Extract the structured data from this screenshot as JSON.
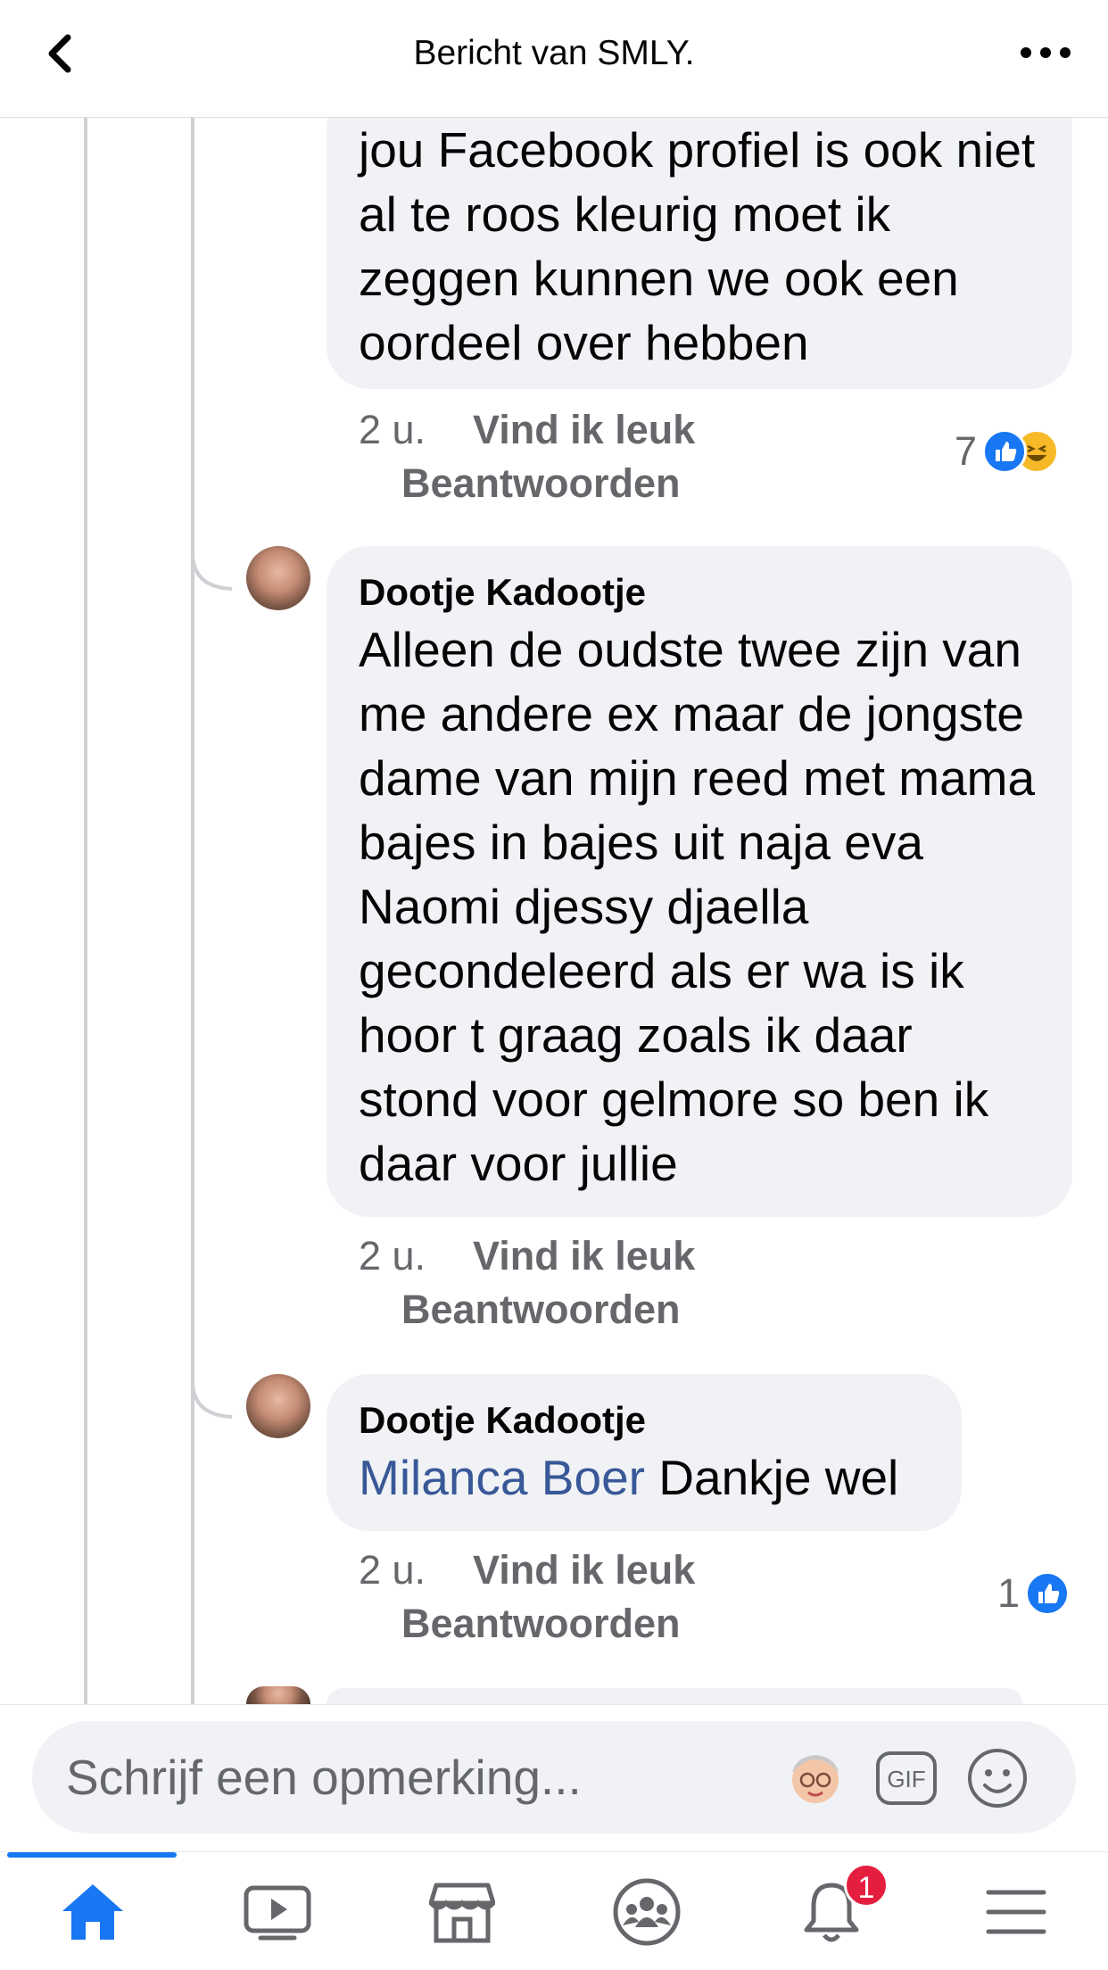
{
  "header": {
    "title": "Bericht van SMLY.",
    "back_icon": "chevron-left-icon",
    "more_icon": "more-horizontal-icon"
  },
  "comments": [
    {
      "author": "",
      "text": "jou Facebook profiel is ook niet al te roos kleurig moet ik zeggen kunnen we ook een oordeel over hebben",
      "time": "2 u.",
      "like_label": "Vind ik leuk",
      "reply_label": "Beantwoorden",
      "reaction_count": "7",
      "reactions": [
        "like",
        "haha"
      ]
    },
    {
      "author": "Dootje Kadootje",
      "text": "Alleen de oudste twee zijn van me andere ex maar de jongste dame van mijn reed met mama bajes in bajes uit naja eva Naomi djessy djaella gecondeleerd als er wa is ik hoor t graag zoals ik daar stond voor gelmore so ben ik daar voor jullie",
      "time": "2 u.",
      "like_label": "Vind ik leuk",
      "reply_label": "Beantwoorden",
      "reaction_count": "",
      "reactions": []
    },
    {
      "author": "Dootje Kadootje",
      "mention": "Milanca Boer",
      "text": "Dankje wel",
      "time": "2 u.",
      "like_label": "Vind ik leuk",
      "reply_label": "Beantwoorden",
      "reaction_count": "1",
      "reactions": [
        "like"
      ]
    }
  ],
  "composer": {
    "placeholder": "Schrijf een opmerking...",
    "avatar_icon": "avatar-sticker-icon",
    "gif_label": "GIF",
    "emoji_icon": "smiley-icon"
  },
  "tabbar": {
    "tabs": [
      {
        "name": "home",
        "icon": "home-icon",
        "active": true
      },
      {
        "name": "watch",
        "icon": "video-play-icon",
        "active": false
      },
      {
        "name": "marketplace",
        "icon": "shop-icon",
        "active": false
      },
      {
        "name": "groups",
        "icon": "groups-icon",
        "active": false
      },
      {
        "name": "notifications",
        "icon": "bell-icon",
        "active": false,
        "badge": "1"
      },
      {
        "name": "menu",
        "icon": "hamburger-icon",
        "active": false
      }
    ],
    "accent": "#1877f2",
    "badge_color": "#e41e3f"
  }
}
